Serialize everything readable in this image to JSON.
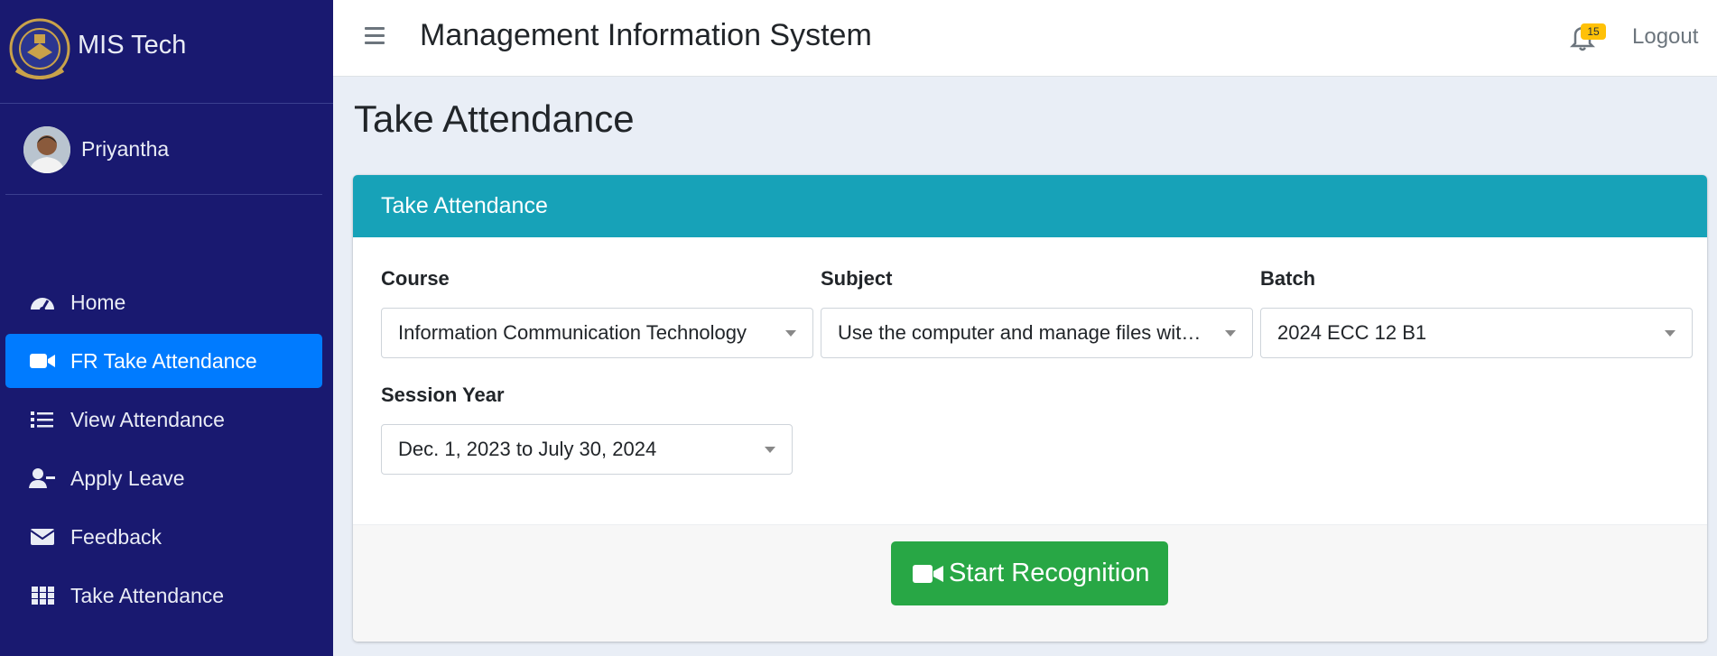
{
  "brand": {
    "name": "MIS Tech"
  },
  "user": {
    "name": "Priyantha"
  },
  "nav": {
    "items": [
      {
        "label": "Home",
        "icon": "dashboard-icon"
      },
      {
        "label": "FR Take Attendance",
        "icon": "video-camera-icon",
        "active": true
      },
      {
        "label": "View Attendance",
        "icon": "list-icon"
      },
      {
        "label": "Apply Leave",
        "icon": "user-minus-icon"
      },
      {
        "label": "Feedback",
        "icon": "envelope-icon"
      },
      {
        "label": "Take Attendance",
        "icon": "grid-icon"
      }
    ]
  },
  "topbar": {
    "title": "Management Information System",
    "notifications": "15",
    "logout": "Logout"
  },
  "page": {
    "heading": "Take Attendance"
  },
  "card": {
    "title": "Take Attendance",
    "course": {
      "label": "Course",
      "value": "Information Communication Technology"
    },
    "subject": {
      "label": "Subject",
      "value": "Use the computer and manage files with an operating system"
    },
    "batch": {
      "label": "Batch",
      "value": "2024 ECC 12 B1"
    },
    "session": {
      "label": "Session Year",
      "value": "Dec. 1, 2023 to July 30, 2024"
    },
    "button": "Start Recognition"
  },
  "colors": {
    "sidebar": "#191970",
    "active": "#007bff",
    "card_header": "#17a2b8",
    "button": "#28a745",
    "badge": "#ffc107"
  }
}
